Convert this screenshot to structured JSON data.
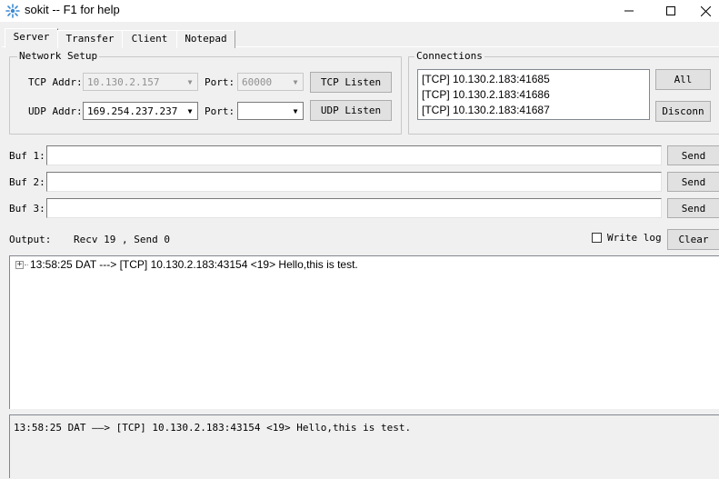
{
  "window": {
    "title": "sokit -- F1 for help"
  },
  "tabs": [
    {
      "label": "Server"
    },
    {
      "label": "Transfer"
    },
    {
      "label": "Client"
    },
    {
      "label": "Notepad"
    }
  ],
  "network_setup": {
    "title": "Network Setup",
    "tcp_addr_label": "TCP Addr:",
    "tcp_addr_value": "10.130.2.157",
    "tcp_port_label": "Port:",
    "tcp_port_value": "60000",
    "tcp_listen_label": "TCP Listen",
    "udp_addr_label": "UDP Addr:",
    "udp_addr_value": "169.254.237.237",
    "udp_port_label": "Port:",
    "udp_port_value": "",
    "udp_listen_label": "UDP Listen"
  },
  "connections": {
    "title": "Connections",
    "items": [
      "[TCP] 10.130.2.183:41685",
      "[TCP] 10.130.2.183:41686",
      "[TCP] 10.130.2.183:41687"
    ],
    "all_label": "All",
    "disconn_label": "Disconn"
  },
  "buffers": [
    {
      "label": "Buf 1:",
      "value": "",
      "send_label": "Send"
    },
    {
      "label": "Buf 2:",
      "value": "",
      "send_label": "Send"
    },
    {
      "label": "Buf 3:",
      "value": "",
      "send_label": "Send"
    }
  ],
  "output": {
    "label": "Output:",
    "stats": "Recv 19 , Send 0",
    "write_log_label": "Write log",
    "write_log_checked": false,
    "clear_label": "Clear",
    "tree_expander": "+",
    "tree_items": [
      "13:58:25 DAT ---> [TCP] 10.130.2.183:43154 <19> Hello,this is test."
    ],
    "detail_text": "13:58:25 DAT ——> [TCP] 10.130.2.183:43154 <19> Hello,this is test."
  }
}
